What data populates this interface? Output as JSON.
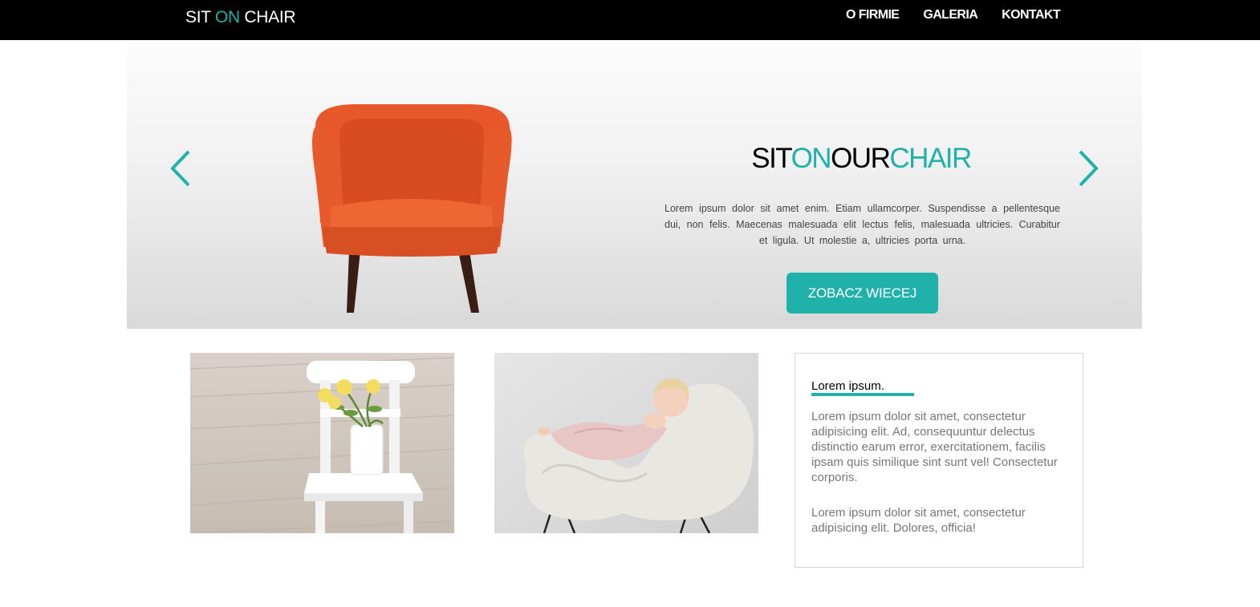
{
  "navbar": {
    "logo": {
      "part1": "SIT",
      "part2": "ON",
      "part3": "CHAIR"
    },
    "menu": [
      "O FIRMIE",
      "GALERIA",
      "KONTAKT"
    ]
  },
  "hero": {
    "title": {
      "w1": "SIT",
      "w2": "ON",
      "w3": "OUR",
      "w4": "CHAIR"
    },
    "text": "Lorem ipsum dolor sit amet enim. Etiam ullamcorper. Suspendisse a pellentesque dui, non felis. Maecenas malesuada elit lectus felis, malesuada ultricies. Curabitur et ligula. Ut molestie a, ultricies porta urna.",
    "button": "ZOBACZ WIECEJ",
    "prev_icon": "chevron-left-icon",
    "next_icon": "chevron-right-icon"
  },
  "info": {
    "title": "Lorem ipsum.",
    "p1": "Lorem ipsum dolor sit amet, consectetur adipisicing elit. Ad, consequuntur delectus distinctio earum error, exercitationem, facilis ipsam quis similique sint sunt vel! Consectetur corporis.",
    "p2": "Lorem ipsum dolor sit amet, consectetur adipisicing elit. Dolores, officia!"
  },
  "colors": {
    "accent": "#20b2aa",
    "navbar_bg": "#000000",
    "chair": "#e8572a"
  }
}
